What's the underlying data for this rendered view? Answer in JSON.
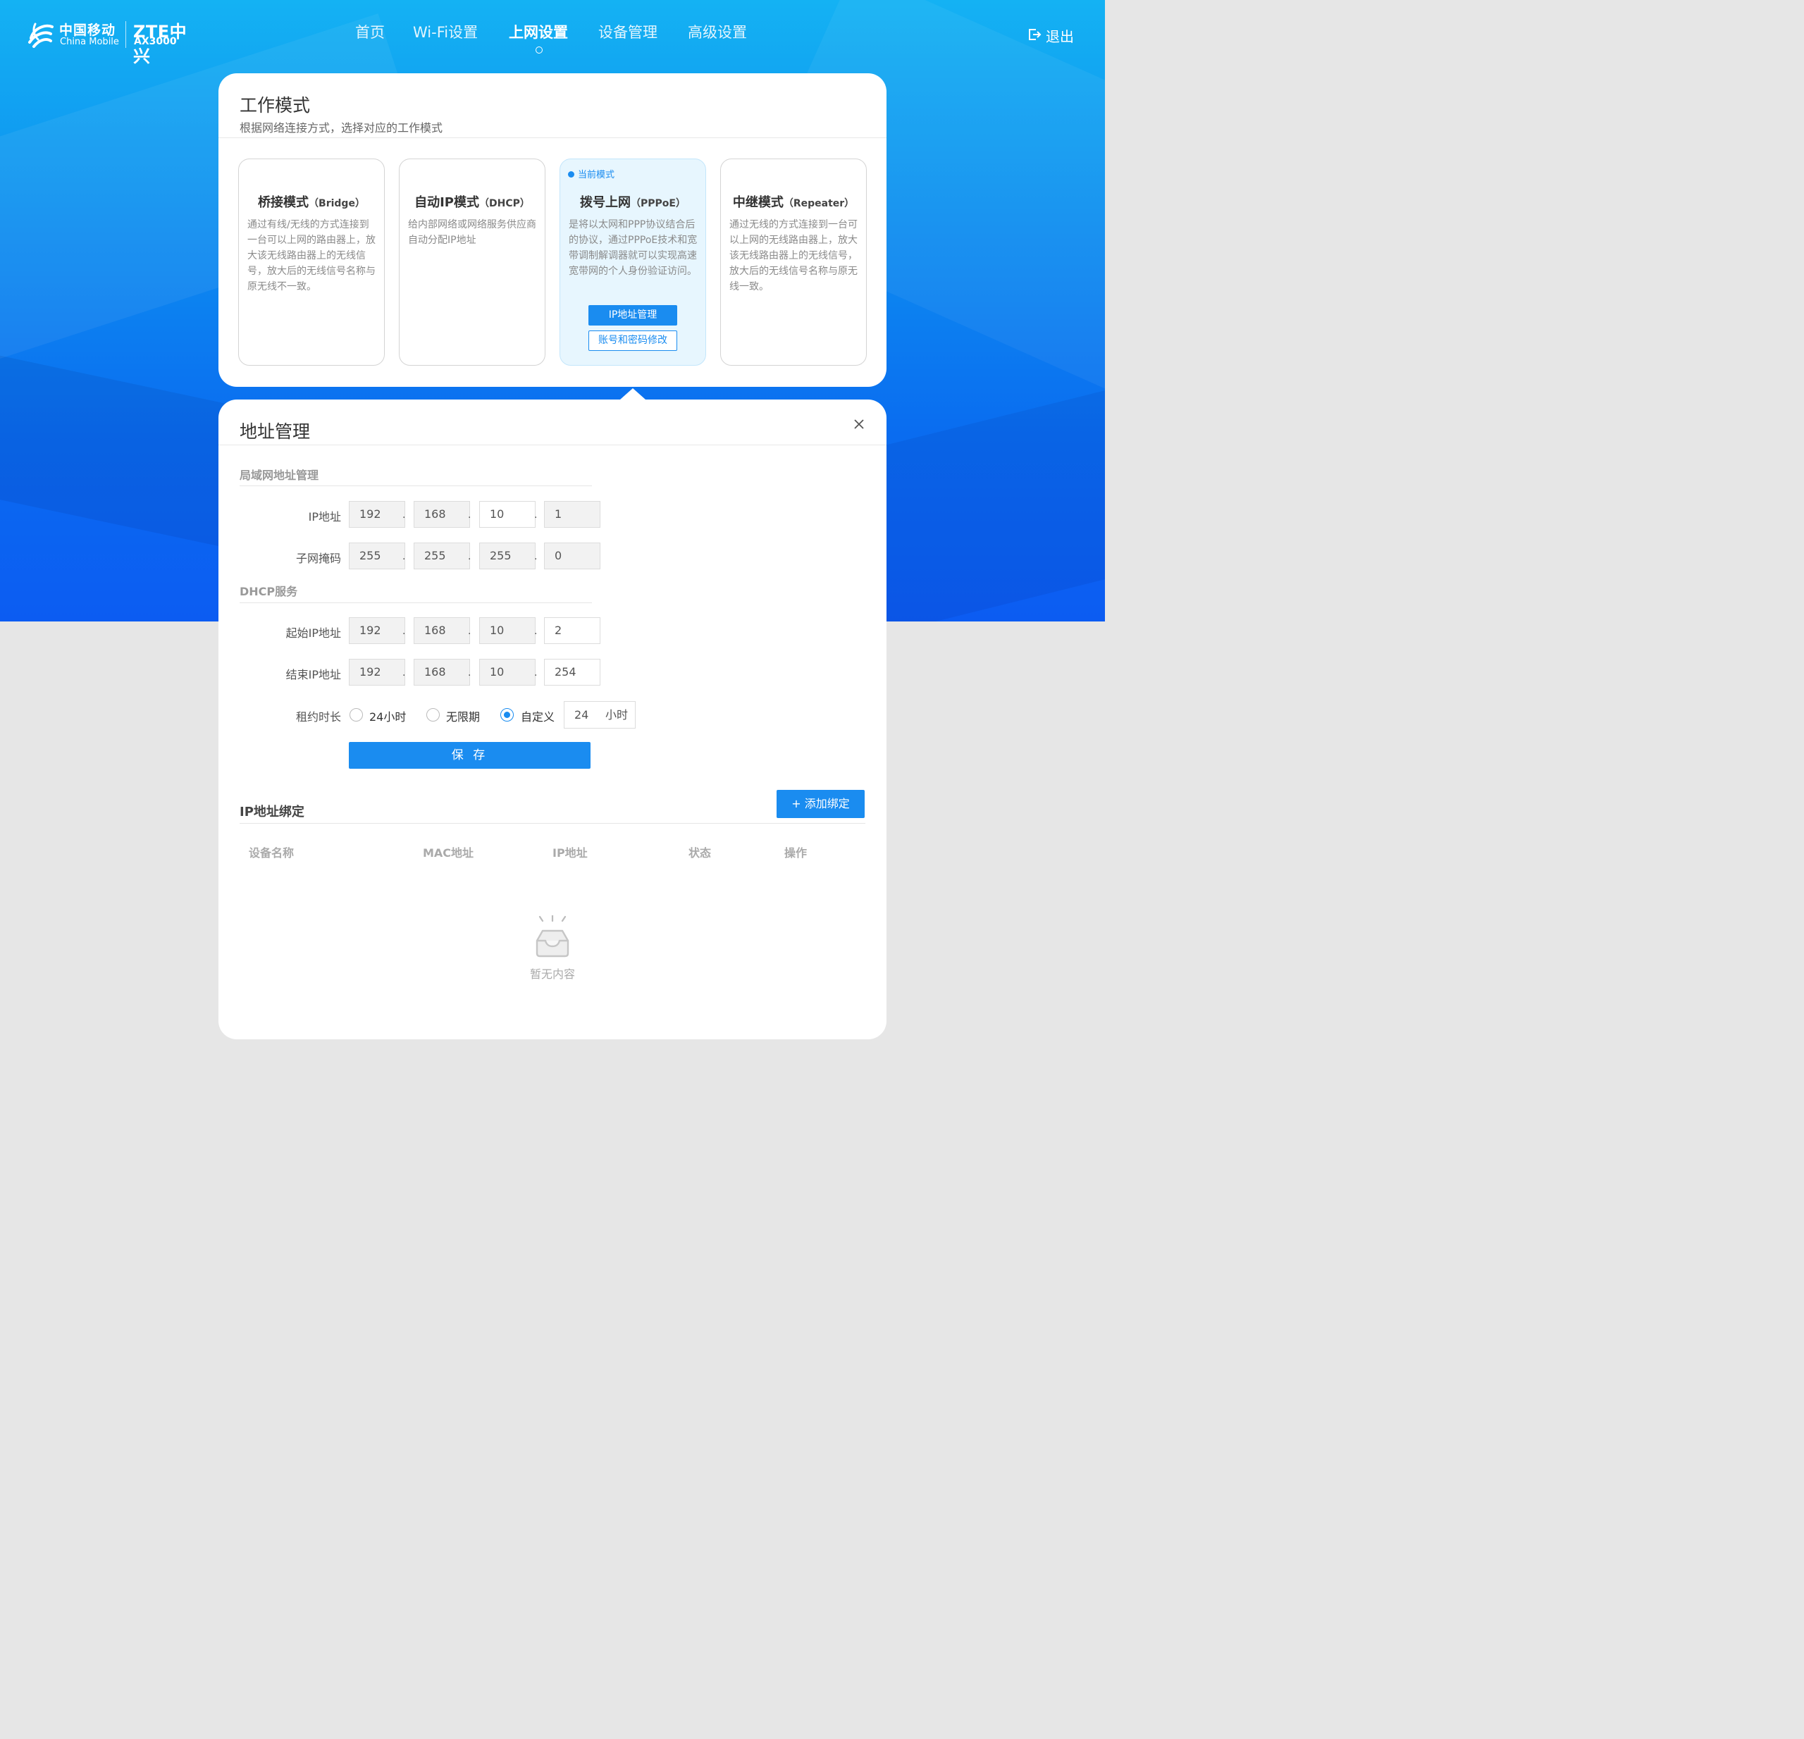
{
  "header": {
    "brand_cn": "中国移动",
    "brand_en": "China Mobile",
    "vendor": "ZTE中兴",
    "model": "AX3000",
    "nav": [
      {
        "label": "首页",
        "active": false
      },
      {
        "label": "Wi-Fi设置",
        "active": false
      },
      {
        "label": "上网设置",
        "active": true
      },
      {
        "label": "设备管理",
        "active": false
      },
      {
        "label": "高级设置",
        "active": false
      }
    ],
    "logout": "退出"
  },
  "work_mode": {
    "title": "工作模式",
    "subtitle": "根据网络连接方式，选择对应的工作模式",
    "modes": [
      {
        "name": "桥接模式",
        "en": "（Bridge）",
        "desc": "通过有线/无线的方式连接到一台可以上网的路由器上，放大该无线路由器上的无线信号，放大后的无线信号名称与原无线不一致。"
      },
      {
        "name": "自动IP模式",
        "en": "（DHCP）",
        "desc": "给内部网络或网络服务供应商自动分配IP地址"
      },
      {
        "name": "拨号上网",
        "en": "（PPPoE）",
        "desc": "是将以太网和PPP协议结合后的协议，通过PPPoE技术和宽带调制解调器就可以实现高速宽带网的个人身份验证访问。",
        "current_tag": "当前模式",
        "btn_ip": "IP地址管理",
        "btn_account": "账号和密码修改"
      },
      {
        "name": "中继模式",
        "en": "（Repeater）",
        "desc": "通过无线的方式连接到一台可以上网的无线路由器上，放大该无线路由器上的无线信号，放大后的无线信号名称与原无线一致。"
      }
    ]
  },
  "address": {
    "title": "地址管理",
    "lan_section": "局域网地址管理",
    "ip_label": "IP地址",
    "ip": [
      "192",
      "168",
      "10",
      "1"
    ],
    "mask_label": "子网掩码",
    "mask": [
      "255",
      "255",
      "255",
      "0"
    ],
    "dhcp_section": "DHCP服务",
    "start_label": "起始IP地址",
    "start": [
      "192",
      "168",
      "10",
      "2"
    ],
    "end_label": "结束IP地址",
    "end": [
      "192",
      "168",
      "10",
      "254"
    ],
    "lease_label": "租约时长",
    "lease_options": [
      "24小时",
      "无限期",
      "自定义"
    ],
    "lease_selected": "自定义",
    "lease_value": "24",
    "lease_unit": "小时",
    "save": "保 存"
  },
  "binding": {
    "title": "IP地址绑定",
    "add": "+ 添加绑定",
    "columns": [
      "设备名称",
      "MAC地址",
      "IP地址",
      "状态",
      "操作"
    ],
    "empty": "暂无内容"
  },
  "colors": {
    "accent": "#1a8cf0",
    "current_bg": "#e7f6fe"
  }
}
